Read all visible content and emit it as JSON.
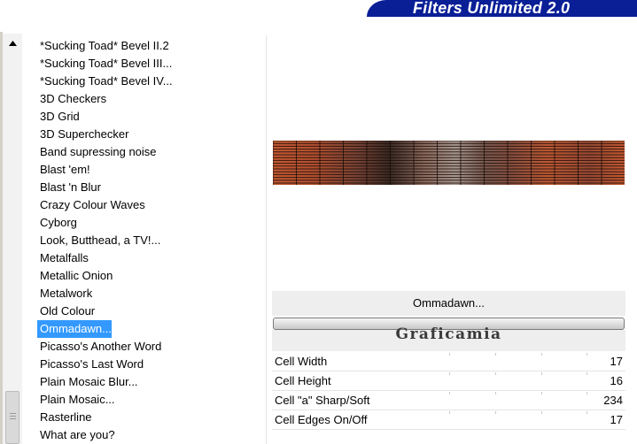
{
  "window": {
    "title": "Filters Unlimited 2.0"
  },
  "filter_list": {
    "items": [
      "*Sucking Toad*  Bevel II.2",
      "*Sucking Toad*  Bevel III...",
      "*Sucking Toad*  Bevel IV...",
      "3D Checkers",
      "3D Grid",
      "3D Superchecker",
      "Band supressing noise",
      "Blast 'em!",
      "Blast 'n Blur",
      "Crazy Colour Waves",
      "Cyborg",
      "Look, Butthead, a TV!...",
      "Metalfalls",
      "Metallic Onion",
      "Metalwork",
      "Old Colour",
      "Ommadawn...",
      "Picasso's Another Word",
      "Picasso's Last Word",
      "Plain Mosaic Blur...",
      "Plain Mosaic...",
      "Rasterline",
      "What are you?"
    ],
    "selected": "Ommadawn..."
  },
  "filter_name": "Ommadawn...",
  "watermark": "Graficamia",
  "preview": {
    "description_colors": {
      "base": "#c65a32",
      "dark": "#3a2a24",
      "light": "#a89890",
      "grid": "#1a0d08"
    }
  },
  "params": [
    {
      "label": "Cell Width",
      "value": "17"
    },
    {
      "label": "Cell Height",
      "value": "16"
    },
    {
      "label": "Cell \"a\" Sharp/Soft",
      "value": "234"
    },
    {
      "label": "Cell Edges On/Off",
      "value": "17"
    }
  ]
}
